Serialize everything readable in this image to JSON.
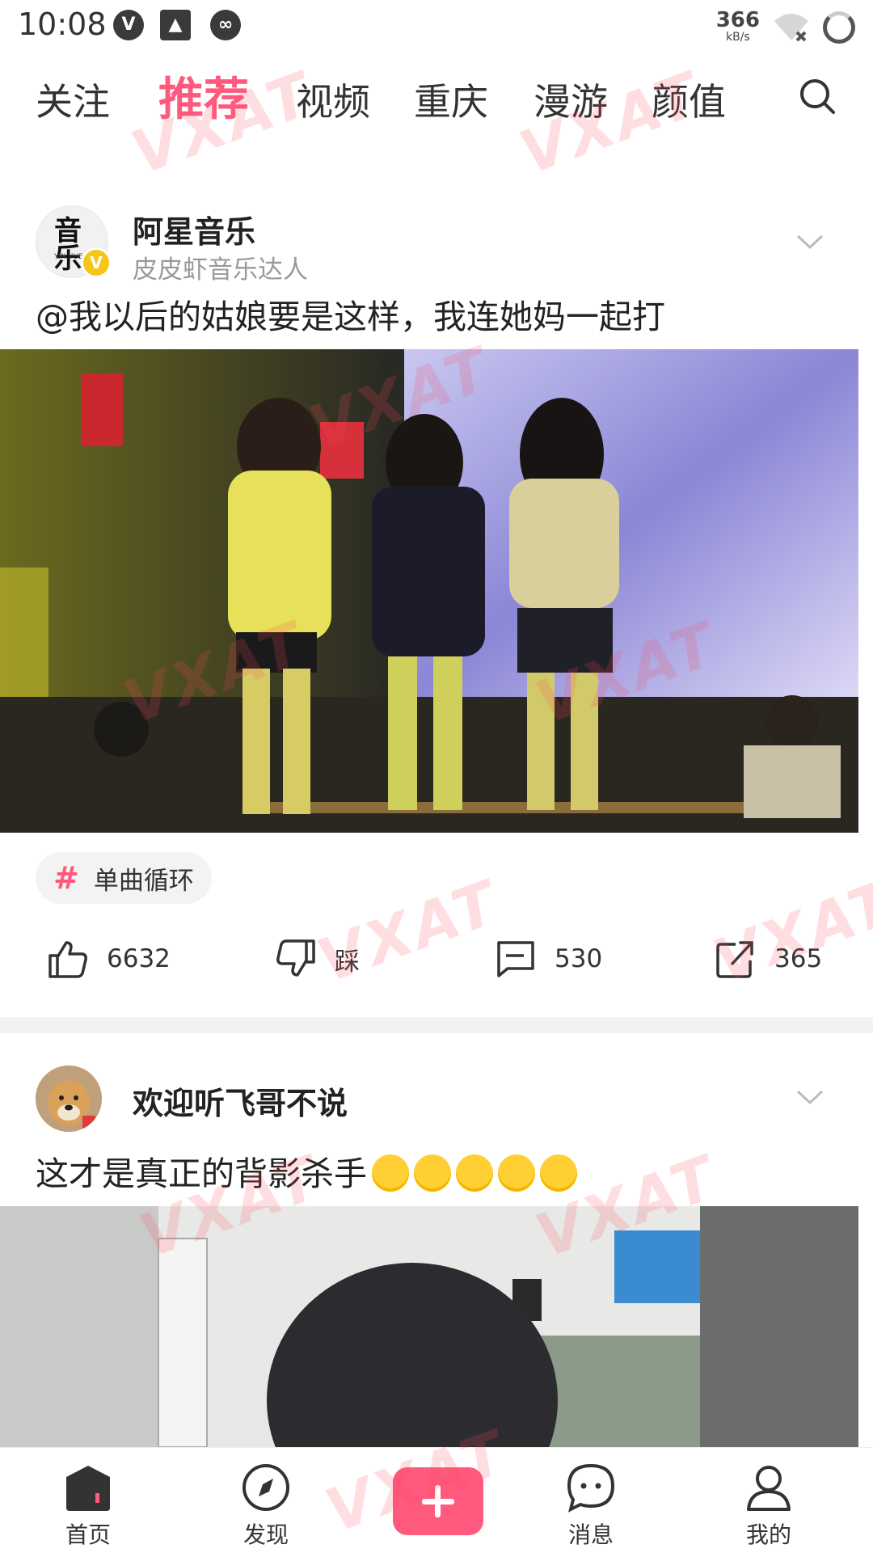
{
  "status_bar": {
    "time": "10:08",
    "icons": [
      "v-badge-icon",
      "image-icon",
      "link-icon"
    ],
    "net_speed": "366",
    "net_unit": "kB/s"
  },
  "tabs": [
    {
      "label": "关注",
      "active": false
    },
    {
      "label": "推荐",
      "active": true
    },
    {
      "label": "视频",
      "active": false
    },
    {
      "label": "重庆",
      "active": false
    },
    {
      "label": "漫游",
      "active": false
    },
    {
      "label": "颜值",
      "active": false
    }
  ],
  "accent_color": "#ff5a7e",
  "post1": {
    "author": "阿星音乐",
    "subtitle": "皮皮虾音乐达人",
    "avatar_text": "音乐",
    "avatar_sub": "YIN YUE",
    "text": "@我以后的姑娘要是这样，我连她妈一起打",
    "tag": "单曲循环",
    "likes": "6632",
    "dislike_label": "踩",
    "comments": "530",
    "shares": "365"
  },
  "post2": {
    "author": "欢迎听飞哥不说",
    "text": "这才是真正的背影杀手"
  },
  "bottom_nav": {
    "home": "首页",
    "discover": "发现",
    "messages": "消息",
    "mine": "我的"
  },
  "watermark": "VXAT"
}
